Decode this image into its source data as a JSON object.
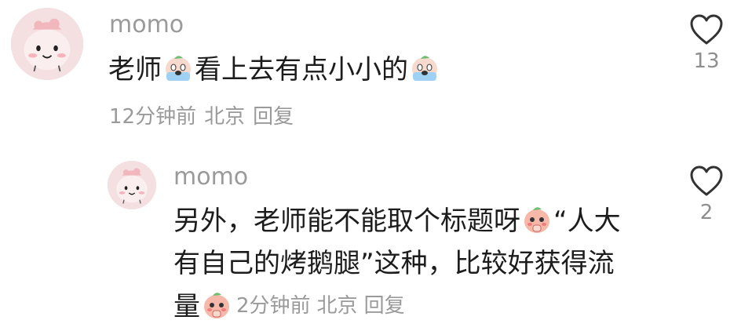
{
  "comment": {
    "username": "momo",
    "text_parts": [
      "老师",
      "看上去有点小小的"
    ],
    "text_emojis": [
      "crying-face-emoji",
      "crying-face-emoji"
    ],
    "time": "12分钟前",
    "location": "北京",
    "reply_label": "回复",
    "like_icon": "heart-outline-icon",
    "like_count": "13"
  },
  "reply": {
    "username": "momo",
    "text_line1_a": "另外，老师能不能取个标题呀",
    "text_line1_b": "“人大",
    "text_line2": "有自己的烤鹅腿”这种，比较好获得流",
    "text_line3": "量",
    "text_emojis": [
      "pleading-peach-emoji",
      "pleading-peach-emoji"
    ],
    "time": "2分钟前",
    "location": "北京",
    "reply_label": "回复",
    "like_icon": "heart-outline-icon",
    "like_count": "2"
  },
  "colors": {
    "text": "#1c1c1c",
    "muted": "#9a9a9a",
    "avatar_bg": "#f4dfe1"
  }
}
